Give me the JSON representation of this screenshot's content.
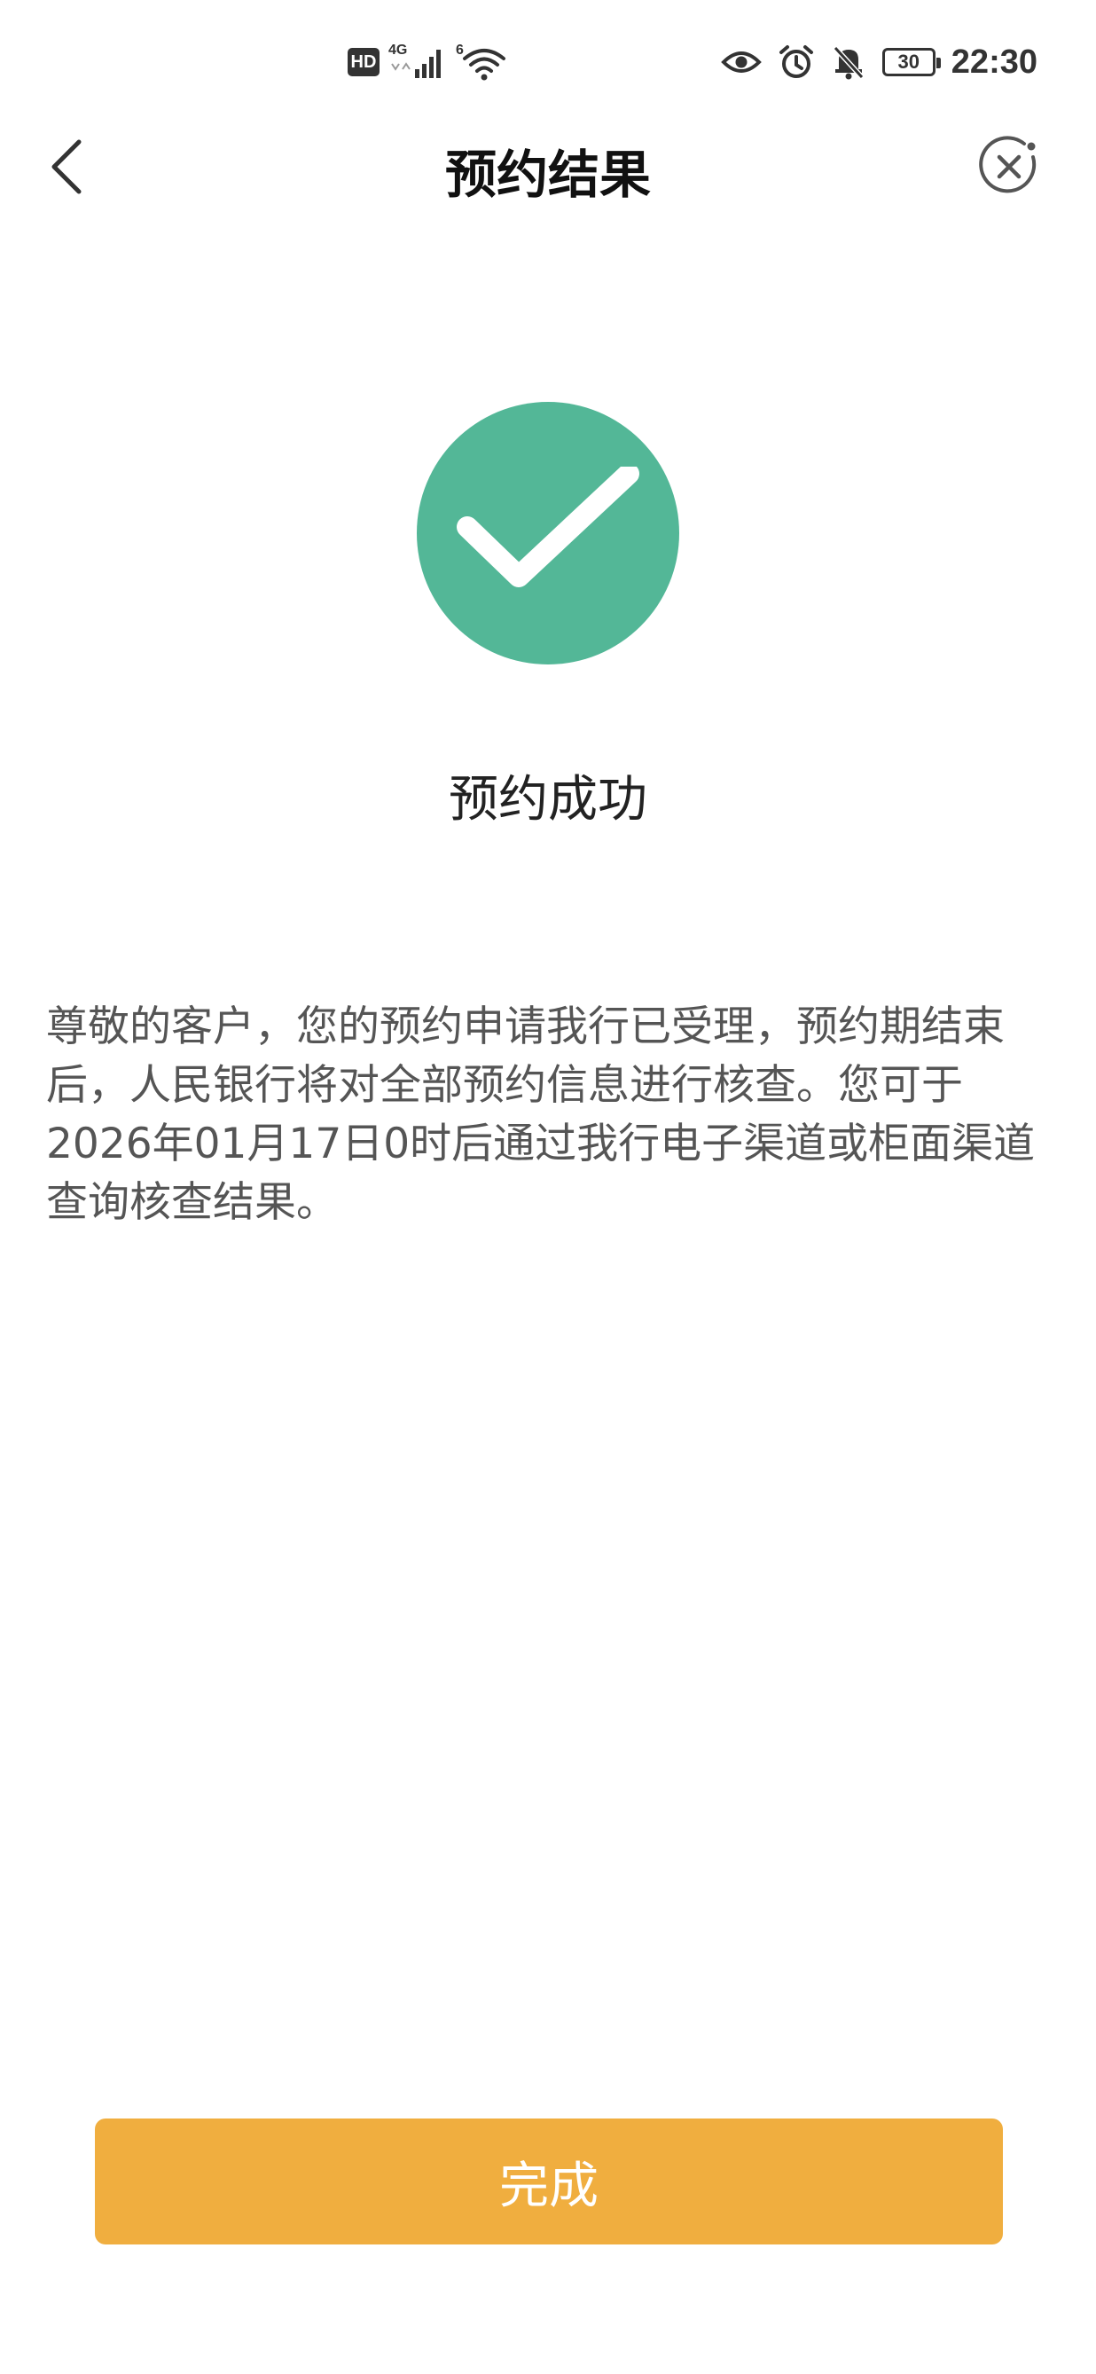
{
  "status_bar": {
    "hd_label": "HD",
    "network_label": "4G",
    "wifi_label": "6",
    "battery": "30",
    "time": "22:30",
    "icons": [
      "hd-icon",
      "signal-icon",
      "wifi-icon",
      "eye-icon",
      "alarm-icon",
      "mute-bell-icon",
      "battery-icon"
    ]
  },
  "nav": {
    "title": "预约结果",
    "back_icon": "chevron-left-icon",
    "close_icon": "close-circle-icon"
  },
  "result": {
    "status_icon": "check-icon",
    "status_color": "#53b797",
    "status_text": "预约成功",
    "description": "尊敬的客户，您的预约申请我行已受理，预约期结束后，人民银行将对全部预约信息进行核查。您可于2026年01月17日0时后通过我行电子渠道或柜面渠道查询核查结果。"
  },
  "actions": {
    "done_label": "完成",
    "done_color": "#f0ae3f"
  }
}
